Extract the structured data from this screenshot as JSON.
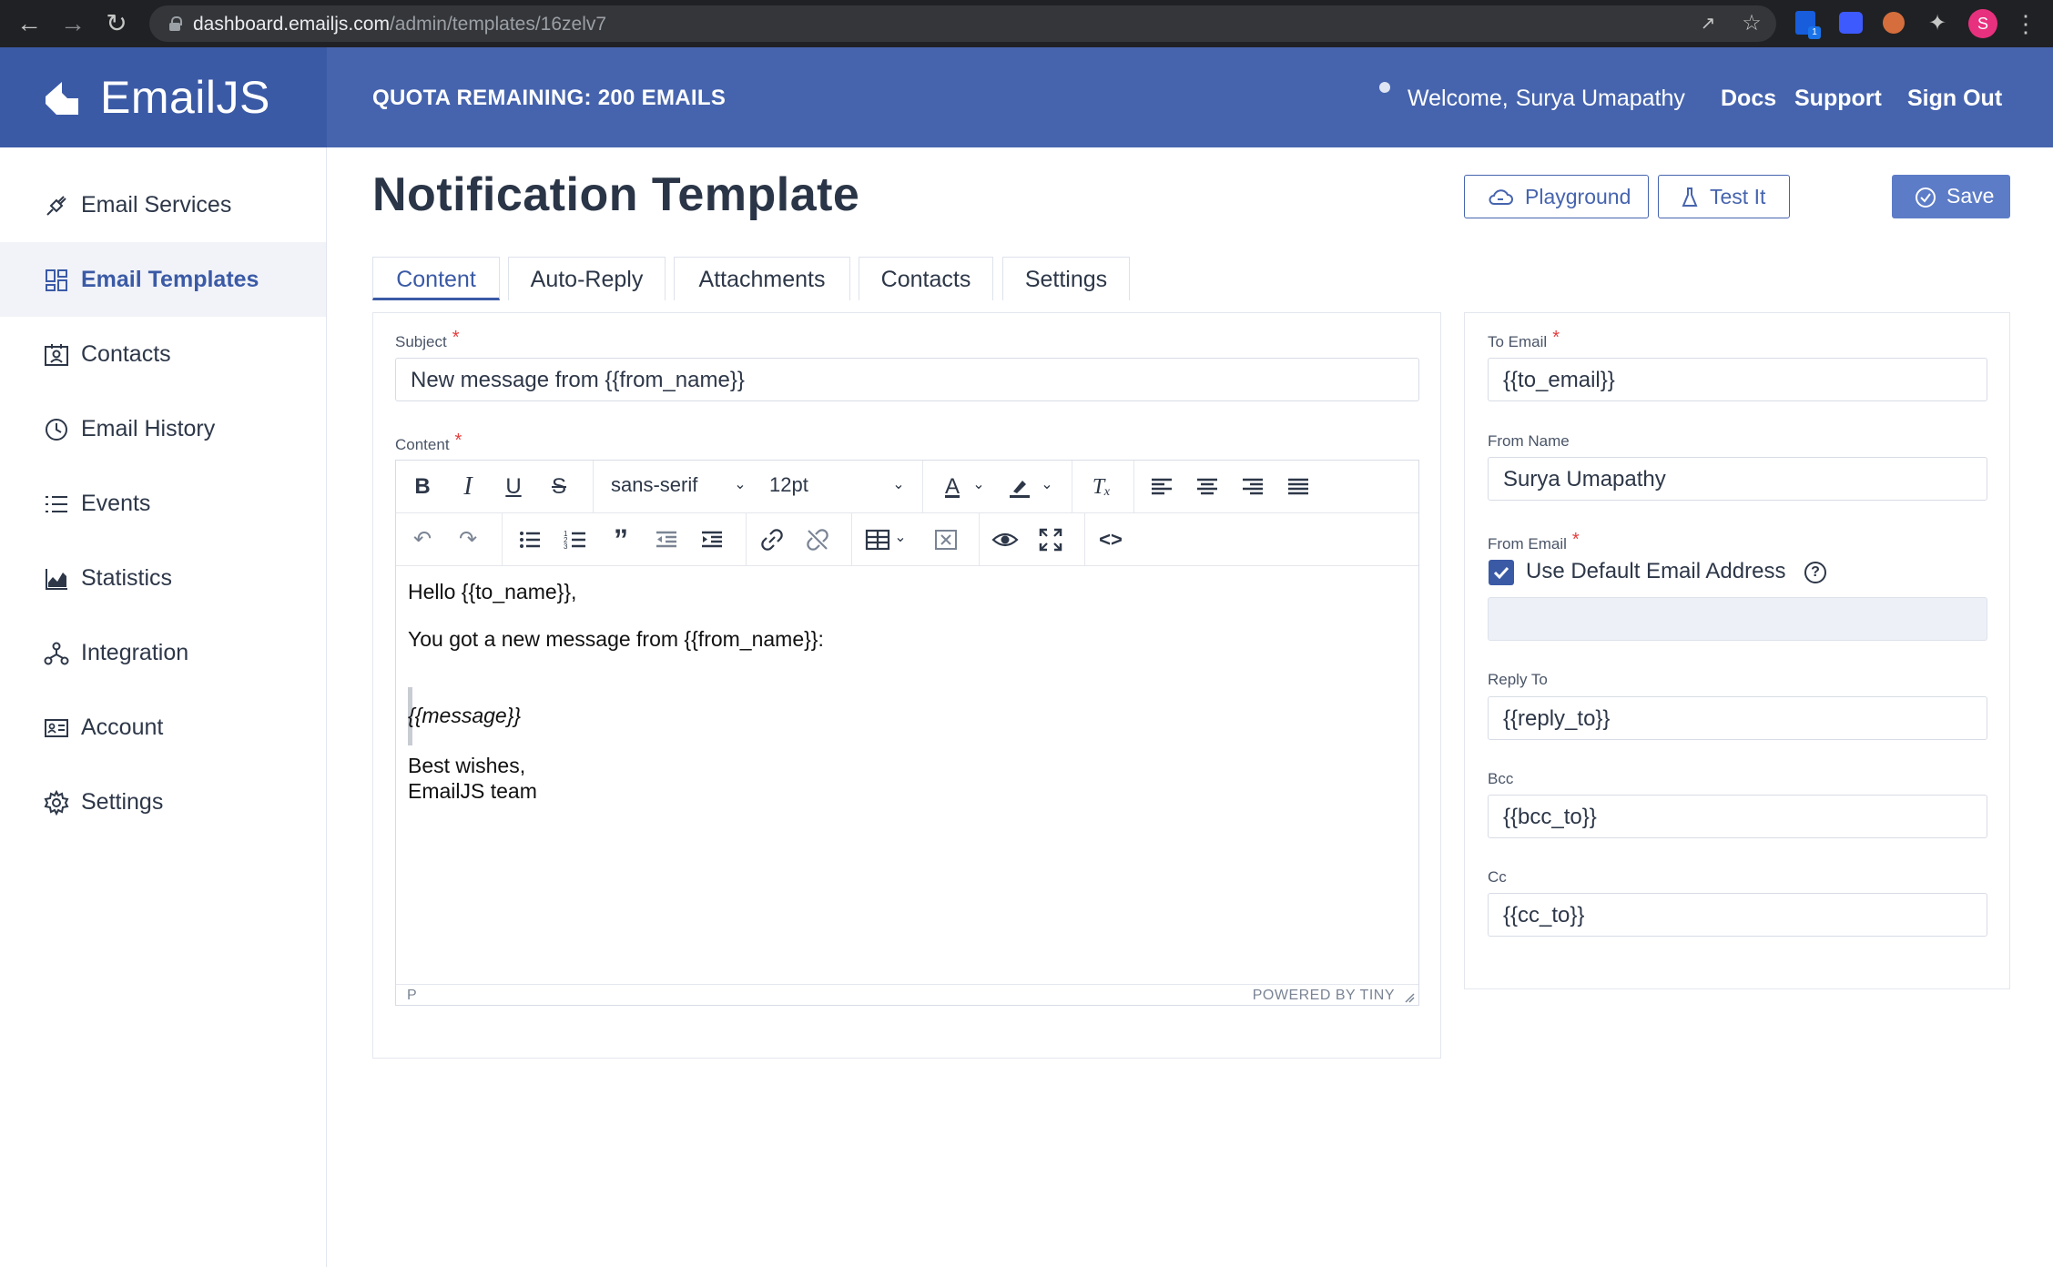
{
  "browser": {
    "url_host": "dashboard.emailjs.com",
    "url_path": "/admin/templates/16zelv7",
    "profile_initial": "S",
    "extension_badge": "1"
  },
  "app": {
    "logo_text": "EmailJS",
    "quota": "QUOTA REMAINING: 200 EMAILS",
    "welcome_prefix": "Welcome,",
    "user_name": "Surya Umapathy",
    "nav_links": {
      "docs": "Docs",
      "support": "Support",
      "signout": "Sign Out"
    },
    "brand_color": "#4664ae"
  },
  "sidebar": {
    "items": [
      {
        "label": "Email Services",
        "icon": "plug-icon",
        "active": false
      },
      {
        "label": "Email Templates",
        "icon": "templates-icon",
        "active": true
      },
      {
        "label": "Contacts",
        "icon": "contacts-icon",
        "active": false
      },
      {
        "label": "Email History",
        "icon": "history-icon",
        "active": false
      },
      {
        "label": "Events",
        "icon": "list-icon",
        "active": false
      },
      {
        "label": "Statistics",
        "icon": "chart-icon",
        "active": false
      },
      {
        "label": "Integration",
        "icon": "integration-icon",
        "active": false
      },
      {
        "label": "Account",
        "icon": "id-card-icon",
        "active": false
      },
      {
        "label": "Settings",
        "icon": "gear-icon",
        "active": false
      }
    ]
  },
  "page": {
    "title": "Notification Template",
    "buttons": {
      "playground": "Playground",
      "test": "Test It",
      "save": "Save"
    },
    "tabs": [
      "Content",
      "Auto-Reply",
      "Attachments",
      "Contacts",
      "Settings"
    ],
    "active_tab": "Content"
  },
  "content": {
    "subject_label": "Subject",
    "subject_value": "New message from {{from_name}}",
    "content_label": "Content",
    "required_mark": "*",
    "toolbar": {
      "font_family": "sans-serif",
      "font_size": "12pt"
    },
    "body": {
      "line1": "Hello {{to_name}},",
      "line2": "You got a new message from {{from_name}}:",
      "quote": "{{message}}",
      "line3": "Best wishes,",
      "line4": "EmailJS team"
    },
    "status_path": "P",
    "powered_by": "POWERED BY TINY"
  },
  "settings_panel": {
    "to_email_label": "To Email",
    "to_email_value": "{{to_email}}",
    "from_name_label": "From Name",
    "from_name_value": "Surya Umapathy",
    "from_email_label": "From Email",
    "use_default_label": "Use Default Email Address",
    "use_default_checked": true,
    "help_glyph": "?",
    "reply_to_label": "Reply To",
    "reply_to_value": "{{reply_to}}",
    "bcc_label": "Bcc",
    "bcc_value": "{{bcc_to}}",
    "cc_label": "Cc",
    "cc_value": "{{cc_to}}"
  }
}
